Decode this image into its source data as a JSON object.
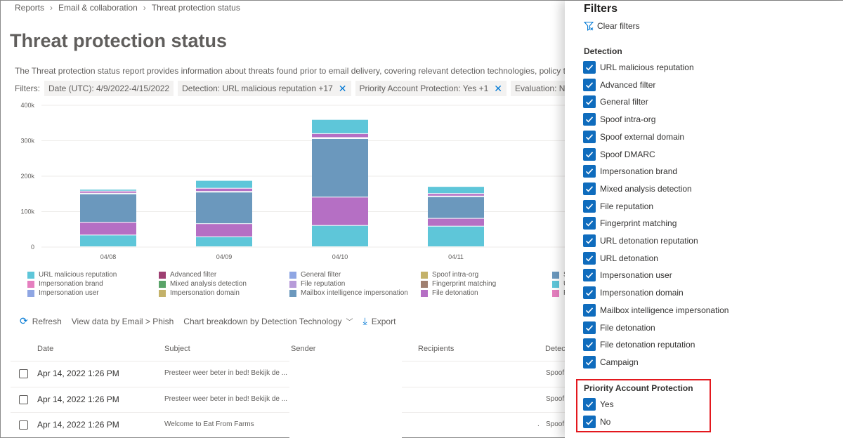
{
  "breadcrumb": [
    "Reports",
    "Email & collaboration",
    "Threat protection status"
  ],
  "page_title": "Threat protection status",
  "description": "The Threat protection status report provides information about threats found prior to email delivery, covering relevant detection technologies, policy types",
  "filters": {
    "label": "Filters:",
    "chips": [
      "Date (UTC): 4/9/2022-4/15/2022",
      "Detection: URL malicious reputation +17",
      "Priority Account Protection: Yes +1",
      "Evaluation: No"
    ]
  },
  "chart_data": {
    "type": "bar",
    "stacked": true,
    "categories": [
      "04/08",
      "04/09",
      "04/10",
      "04/11"
    ],
    "y_ticks": [
      "0",
      "100k",
      "200k",
      "300k",
      "400k"
    ],
    "ylim": [
      0,
      400000
    ],
    "grid": true,
    "series": [
      {
        "name": "URL malicious reputation",
        "color": "#5ec6d9",
        "values": [
          33000,
          28000,
          60000,
          58000
        ]
      },
      {
        "name": "Mailbox intelligence impersonation",
        "color": "#b56fc4",
        "values": [
          36000,
          37000,
          80000,
          22000
        ]
      },
      {
        "name": "Impersonation domain",
        "color": "#6b98bd",
        "values": [
          80000,
          89000,
          165000,
          61000
        ]
      },
      {
        "name": "Impersonation user",
        "color": "#e9e9f0",
        "values": [
          2000,
          2000,
          3000,
          2000
        ]
      },
      {
        "name": "Advanced filter",
        "color": "#b56fc4",
        "values": [
          6000,
          9000,
          11000,
          7000
        ]
      },
      {
        "name": "Spoof external domain",
        "color": "#5ec6d9",
        "values": [
          5000,
          22000,
          40000,
          20000
        ]
      }
    ]
  },
  "legend": [
    {
      "label": "URL malicious reputation",
      "color": "#5ec6d9"
    },
    {
      "label": "Advanced filter",
      "color": "#9e3f72"
    },
    {
      "label": "General filter",
      "color": "#8fa6e3"
    },
    {
      "label": "Spoof intra-org",
      "color": "#c4b26a"
    },
    {
      "label": "Impersonation brand",
      "color": "#e57fbf"
    },
    {
      "label": "Mixed analysis detection",
      "color": "#5aa469"
    },
    {
      "label": "File reputation",
      "color": "#b79bd9"
    },
    {
      "label": "Fingerprint matching",
      "color": "#a08070"
    },
    {
      "label": "Impersonation user",
      "color": "#8fa6e3"
    },
    {
      "label": "Impersonation domain",
      "color": "#c4b26a"
    },
    {
      "label": "Mailbox intelligence impersonation",
      "color": "#6b98bd"
    },
    {
      "label": "File detonation",
      "color": "#b56fc4"
    },
    {
      "label": "S",
      "color": "#6b98bd"
    },
    {
      "label": "U",
      "color": "#5ec6d9"
    },
    {
      "label": "F",
      "color": "#e57fbf"
    }
  ],
  "toolbar": {
    "refresh": "Refresh",
    "view_data": "View data by Email > Phish",
    "breakdown": "Chart breakdown by Detection Technology",
    "export": "Export"
  },
  "table": {
    "headers": [
      "Date",
      "Subject",
      "Sender",
      "Recipients",
      "Detect"
    ],
    "rows": [
      {
        "date": "Apr 14, 2022 1:26 PM",
        "subject": "Presteer weer beter in bed! Bekijk de ...",
        "detection": "Spoof"
      },
      {
        "date": "Apr 14, 2022 1:26 PM",
        "subject": "Presteer weer beter in bed! Bekijk de ...",
        "detection": "Spoof"
      },
      {
        "date": "Apr 14, 2022 1:26 PM",
        "subject": "Welcome to Eat From Farms",
        "detection": "Spoof"
      }
    ]
  },
  "pane": {
    "title": "Filters",
    "clear_filters": "Clear filters",
    "detection_heading": "Detection",
    "detection_options": [
      "URL malicious reputation",
      "Advanced filter",
      "General filter",
      "Spoof intra-org",
      "Spoof external domain",
      "Spoof DMARC",
      "Impersonation brand",
      "Mixed analysis detection",
      "File reputation",
      "Fingerprint matching",
      "URL detonation reputation",
      "URL detonation",
      "Impersonation user",
      "Impersonation domain",
      "Mailbox intelligence impersonation",
      "File detonation",
      "File detonation reputation",
      "Campaign"
    ],
    "priority_heading": "Priority Account Protection",
    "priority_options": [
      "Yes",
      "No"
    ],
    "accent_color": "#0f6cbd",
    "highlight_color": "#e3181e"
  }
}
